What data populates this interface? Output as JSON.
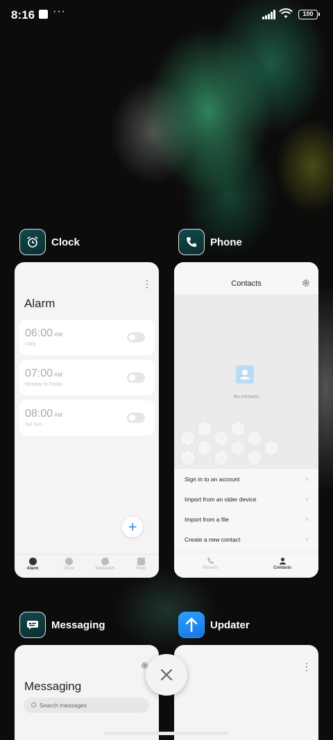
{
  "status_bar": {
    "time": "8:16",
    "more": "···",
    "battery": "100"
  },
  "clock": {
    "app_name": "Clock",
    "title": "Alarm",
    "more": "⋮",
    "alarms": [
      {
        "time": "06:00",
        "ampm": "AM",
        "repeat": "Daily"
      },
      {
        "time": "07:00",
        "ampm": "AM",
        "repeat": "Monday to Friday"
      },
      {
        "time": "08:00",
        "ampm": "AM",
        "repeat": "Sat Sun"
      }
    ],
    "fab": "+",
    "nav": [
      "Alarm",
      "Clock",
      "Stopwatch",
      "Timer"
    ]
  },
  "phone": {
    "app_name": "Phone",
    "title": "Contacts",
    "empty_text": "No contacts",
    "actions": [
      "Sign in to an account",
      "Import from an older device",
      "Import from a file",
      "Create a new contact"
    ],
    "chevron": "›",
    "nav": [
      "Recents",
      "Contacts"
    ]
  },
  "messaging": {
    "app_name": "Messaging",
    "title": "Messaging",
    "search_placeholder": "Search messages"
  },
  "updater": {
    "app_name": "Updater",
    "more": "⋮"
  }
}
